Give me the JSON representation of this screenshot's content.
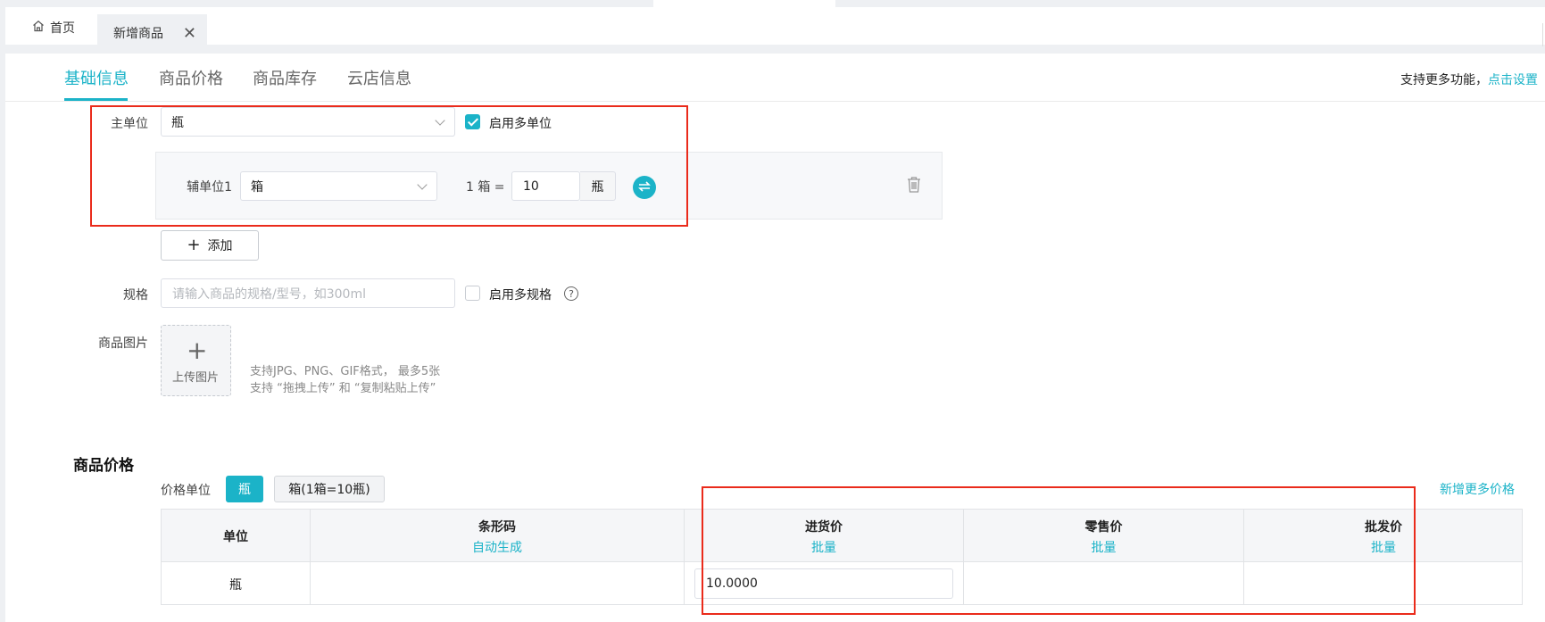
{
  "tabs": {
    "home": "首页",
    "active": "新增商品",
    "close_symbol": "✕"
  },
  "nav": {
    "tabs": [
      "基础信息",
      "商品价格",
      "商品库存",
      "云店信息"
    ],
    "support_text": "支持更多功能，",
    "support_link": "点击设置"
  },
  "form": {
    "main_unit_label": "主单位",
    "main_unit_value": "瓶",
    "multi_unit_label": "启用多单位",
    "multi_unit_checked": true,
    "aux_unit_label": "辅单位1",
    "aux_unit_value": "箱",
    "conversion_prefix": "1 箱 =",
    "conversion_value": "10",
    "conversion_unit": "瓶",
    "add_button": "添加",
    "spec_label": "规格",
    "spec_placeholder": "请输入商品的规格/型号，如300ml",
    "multi_spec_label": "启用多规格",
    "multi_spec_checked": false,
    "help_symbol": "?",
    "image_label": "商品图片",
    "upload_text": "上传图片",
    "upload_hint_1": "支持JPG、PNG、GIF格式， 最多5张",
    "upload_hint_2": "支持 “拖拽上传” 和 “复制粘贴上传”"
  },
  "prices": {
    "title": "商品价格",
    "unit_label": "价格单位",
    "unit_options": [
      "瓶",
      "箱(1箱=10瓶)"
    ],
    "selected_unit": "瓶",
    "more_link": "新增更多价格",
    "columns": [
      {
        "title": "单位",
        "sub": ""
      },
      {
        "title": "条形码",
        "sub": "自动生成"
      },
      {
        "title": "进货价",
        "sub": "批量"
      },
      {
        "title": "零售价",
        "sub": "批量"
      },
      {
        "title": "批发价",
        "sub": "批量"
      }
    ],
    "rows": [
      {
        "unit": "瓶",
        "barcode": "",
        "purchase": "10.0000",
        "retail": "",
        "wholesale": ""
      }
    ]
  },
  "colors": {
    "accent": "#1bb3c8",
    "highlight_box": "#ea2b1b"
  }
}
